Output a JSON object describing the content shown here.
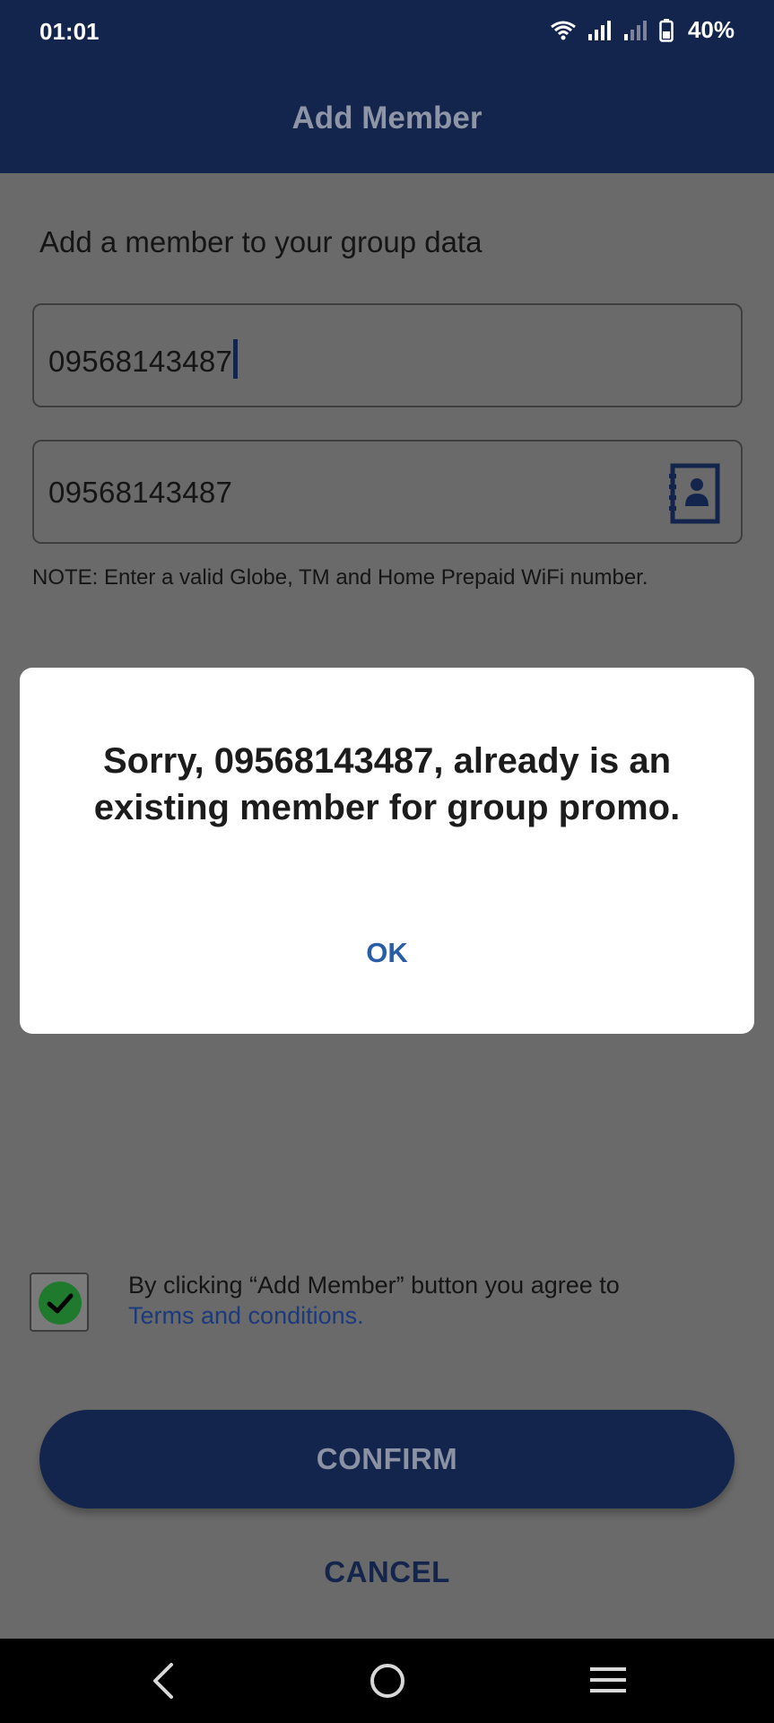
{
  "status_bar": {
    "time": "01:01",
    "battery": "40%"
  },
  "header": {
    "title": "Add Member"
  },
  "form": {
    "subtitle": "Add a member to your group data",
    "mobile_value": "09568143487",
    "confirm_value": "09568143487",
    "note": "NOTE: Enter a valid Globe, TM and Home Prepaid WiFi number."
  },
  "terms": {
    "text": "By clicking “Add Member” button you agree to",
    "link": "Terms and conditions.",
    "checked": true
  },
  "actions": {
    "confirm": "CONFIRM",
    "cancel": "CANCEL"
  },
  "dialog": {
    "message": "Sorry, 09568143487, already is an existing member for group promo.",
    "ok": "OK"
  },
  "colors": {
    "primary": "#13254c",
    "link": "#2a5da6",
    "check": "#1f7a2e"
  }
}
